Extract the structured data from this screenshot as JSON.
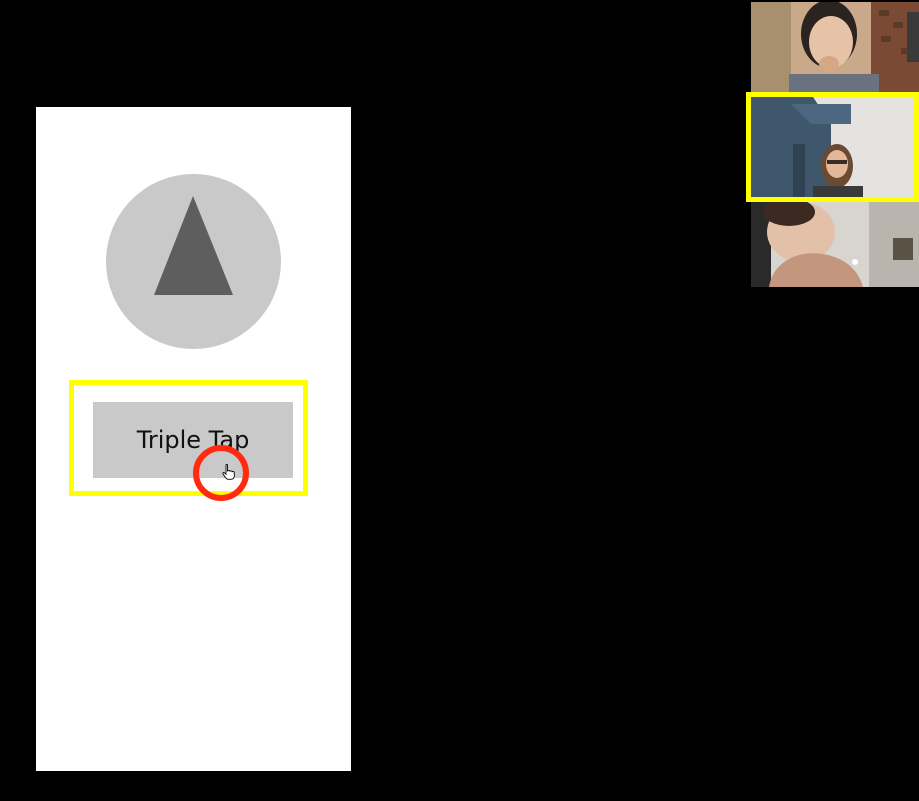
{
  "app": {
    "background_color": "#000000"
  },
  "prototype": {
    "screen_background": "#ffffff",
    "play_button": {
      "icon": "play-triangle-icon",
      "fill_color": "#c9c9c9",
      "icon_color": "#5e5e5e"
    },
    "action_button": {
      "label": "Triple Tap",
      "fill_color": "#c9c9c9"
    },
    "highlight_color": "#ffff00",
    "click_indicator_color": "#ff2a10",
    "cursor_icon": "hand-pointer-icon"
  },
  "video_call": {
    "participants": [
      {
        "name_visible": false,
        "active_speaker": false
      },
      {
        "name_visible": false,
        "active_speaker": true
      },
      {
        "name_visible": false,
        "active_speaker": false
      }
    ],
    "active_speaker_highlight": "#ffff00"
  }
}
